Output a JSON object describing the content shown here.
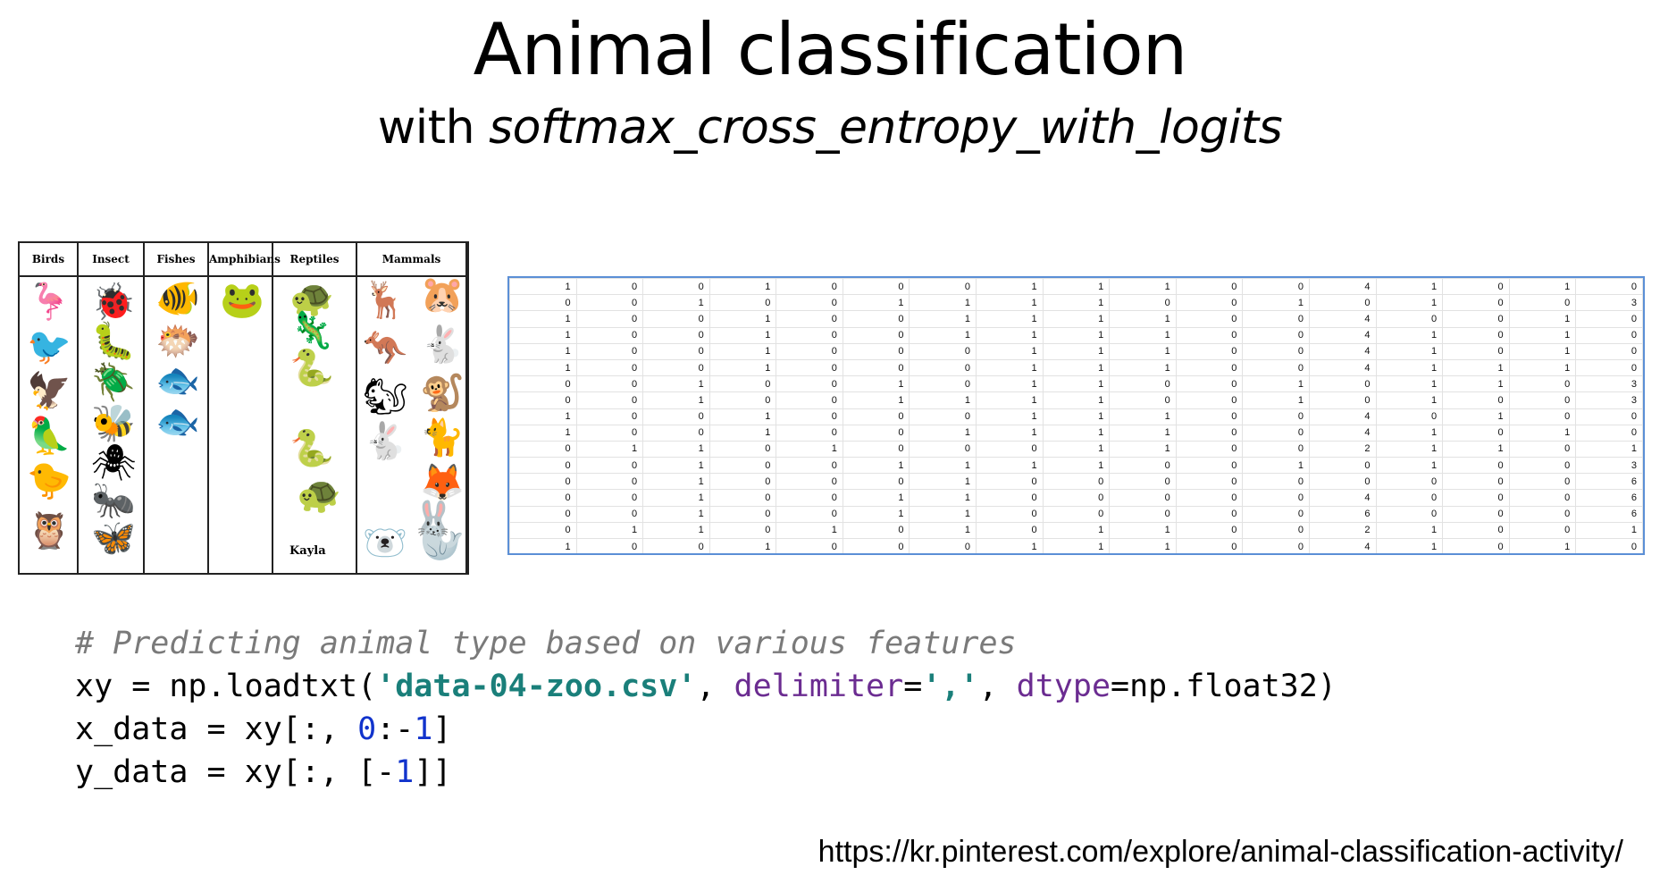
{
  "title": "Animal classification",
  "subtitle": {
    "prefix": "with ",
    "function": "softmax_cross_entropy_with_logits"
  },
  "animal_chart": {
    "columns": [
      "Birds",
      "Insect",
      "Fishes",
      "Amphibians",
      "Reptiles",
      "Mammals"
    ],
    "signature": "Kayla",
    "icons": {
      "birds": [
        "flamingo-icon",
        "sparrow-icon",
        "eagle-icon",
        "toucan-icon",
        "hummingbird-icon",
        "owl-icon"
      ],
      "insect": [
        "ladybug-icon",
        "caterpillar-icon",
        "beetle-icon",
        "bee-icon",
        "spider-icon",
        "ant-icon",
        "butterfly-icon"
      ],
      "fishes": [
        "angelfish-icon",
        "pufferfish-icon",
        "red-fish-icon",
        "trout-icon"
      ],
      "amphibians": [
        "frog-icon"
      ],
      "reptiles": [
        "turtle-icon",
        "lizard-icon",
        "snake-icon",
        "small-snake-icon",
        "sea-turtle-icon"
      ],
      "mammals": [
        "deer-icon",
        "hamster-icon",
        "kangaroo-icon",
        "rabbit-icon",
        "squirrel-icon",
        "lemur-icon",
        "hare-icon",
        "cat-icon",
        "fox-icon",
        "rabbits-icon",
        "polar-bear-icon",
        "seal-icon"
      ]
    }
  },
  "zoo_table": {
    "rows": [
      [
        1,
        0,
        0,
        1,
        0,
        0,
        0,
        1,
        1,
        1,
        0,
        0,
        4,
        1,
        0,
        1,
        0
      ],
      [
        0,
        0,
        1,
        0,
        0,
        1,
        1,
        1,
        1,
        0,
        0,
        1,
        0,
        1,
        0,
        0,
        3
      ],
      [
        1,
        0,
        0,
        1,
        0,
        0,
        1,
        1,
        1,
        1,
        0,
        0,
        4,
        0,
        0,
        1,
        0
      ],
      [
        1,
        0,
        0,
        1,
        0,
        0,
        1,
        1,
        1,
        1,
        0,
        0,
        4,
        1,
        0,
        1,
        0
      ],
      [
        1,
        0,
        0,
        1,
        0,
        0,
        0,
        1,
        1,
        1,
        0,
        0,
        4,
        1,
        0,
        1,
        0
      ],
      [
        1,
        0,
        0,
        1,
        0,
        0,
        0,
        1,
        1,
        1,
        0,
        0,
        4,
        1,
        1,
        1,
        0
      ],
      [
        0,
        0,
        1,
        0,
        0,
        1,
        0,
        1,
        1,
        0,
        0,
        1,
        0,
        1,
        1,
        0,
        3
      ],
      [
        0,
        0,
        1,
        0,
        0,
        1,
        1,
        1,
        1,
        0,
        0,
        1,
        0,
        1,
        0,
        0,
        3
      ],
      [
        1,
        0,
        0,
        1,
        0,
        0,
        0,
        1,
        1,
        1,
        0,
        0,
        4,
        0,
        1,
        0,
        0
      ],
      [
        1,
        0,
        0,
        1,
        0,
        0,
        1,
        1,
        1,
        1,
        0,
        0,
        4,
        1,
        0,
        1,
        0
      ],
      [
        0,
        1,
        1,
        0,
        1,
        0,
        0,
        0,
        1,
        1,
        0,
        0,
        2,
        1,
        1,
        0,
        1
      ],
      [
        0,
        0,
        1,
        0,
        0,
        1,
        1,
        1,
        1,
        0,
        0,
        1,
        0,
        1,
        0,
        0,
        3
      ],
      [
        0,
        0,
        1,
        0,
        0,
        0,
        1,
        0,
        0,
        0,
        0,
        0,
        0,
        0,
        0,
        0,
        6
      ],
      [
        0,
        0,
        1,
        0,
        0,
        1,
        1,
        0,
        0,
        0,
        0,
        0,
        4,
        0,
        0,
        0,
        6
      ],
      [
        0,
        0,
        1,
        0,
        0,
        1,
        1,
        0,
        0,
        0,
        0,
        0,
        6,
        0,
        0,
        0,
        6
      ],
      [
        0,
        1,
        1,
        0,
        1,
        0,
        1,
        0,
        1,
        1,
        0,
        0,
        2,
        1,
        0,
        0,
        1
      ],
      [
        1,
        0,
        0,
        1,
        0,
        0,
        0,
        1,
        1,
        1,
        0,
        0,
        4,
        1,
        0,
        1,
        0
      ]
    ]
  },
  "code": {
    "comment": "# Predicting animal type based on various features",
    "line1": {
      "a": "xy = np.loadtxt(",
      "str": "'data-04-zoo.csv'",
      "b": ", ",
      "kw1": "delimiter",
      "c": "=",
      "str2": "','",
      "d": ", ",
      "kw2": "dtype",
      "e": "=np.float32)"
    },
    "line2": {
      "a": "x_data = xy[:, ",
      "n1": "0",
      "b": ":-",
      "n2": "1",
      "c": "]"
    },
    "line3": {
      "a": "y_data = xy[:, [-",
      "n1": "1",
      "b": "]]"
    }
  },
  "source_url": "https://kr.pinterest.com/explore/animal-classification-activity/"
}
